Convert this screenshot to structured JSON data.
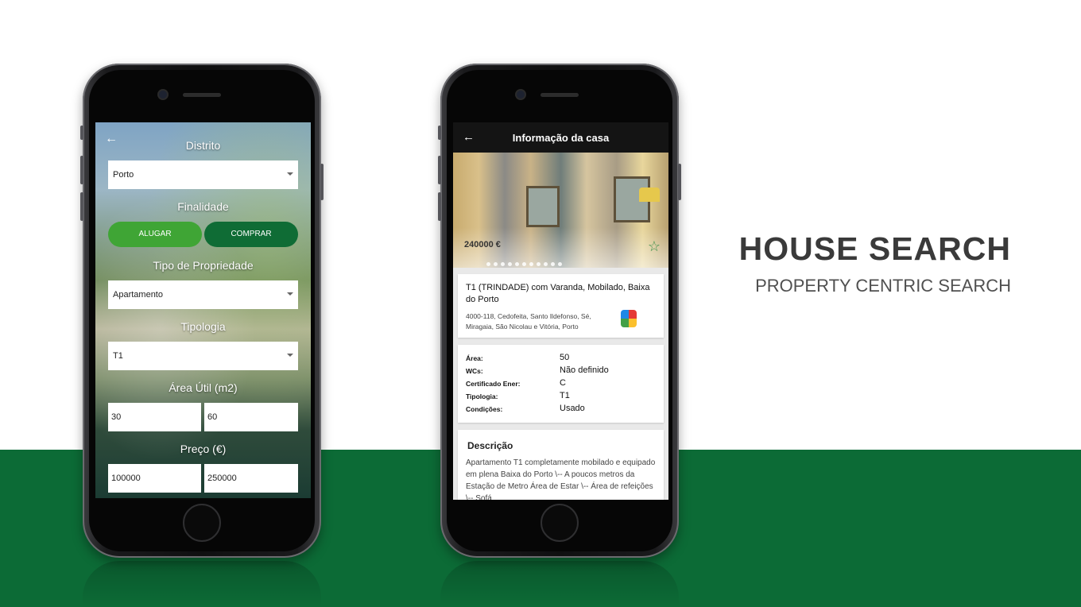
{
  "heading": {
    "title": "HOUSE SEARCH",
    "subtitle": "PROPERTY CENTRIC SEARCH"
  },
  "colors": {
    "brand_green": "#0c6b36",
    "toggle_light": "#3fa535",
    "toggle_dark": "#0f6c35"
  },
  "search_screen": {
    "back_icon": "←",
    "distrito_label": "Distrito",
    "distrito_value": "Porto",
    "finalidade_label": "Finalidade",
    "alugar_label": "ALUGAR",
    "comprar_label": "COMPRAR",
    "tipo_label": "Tipo de Propriedade",
    "tipo_value": "Apartamento",
    "tipologia_label": "Tipologia",
    "tipologia_value": "T1",
    "area_label": "Área Útil (m2)",
    "area_min": "30",
    "area_max": "60",
    "preco_label": "Preço (€)",
    "preco_min": "100000",
    "preco_max": "250000"
  },
  "detail_screen": {
    "back_icon": "←",
    "title": "Informação da casa",
    "price": "240000 €",
    "star_icon": "☆",
    "listing_title": "T1 (TRINDADE) com Varanda, Mobilado, Baixa do Porto",
    "address": "4000-118,  Cedofeita, Santo Ildefonso, Sé, Miragaia, São Nicolau e Vitória,  Porto",
    "specs": [
      {
        "key": "Área:",
        "value": "50"
      },
      {
        "key": "WCs:",
        "value": "Não definido"
      },
      {
        "key": "Certificado Ener:",
        "value": "C"
      },
      {
        "key": "Tipologia:",
        "value": "T1"
      },
      {
        "key": "Condições:",
        "value": "Usado"
      }
    ],
    "description_title": "Descrição",
    "description": " Apartamento T1 completamente mobilado e equipado em plena Baixa do Porto \\-- A poucos metros da Estação de Metro Área de Estar \\-- Área de refeições \\-- Sofá"
  }
}
